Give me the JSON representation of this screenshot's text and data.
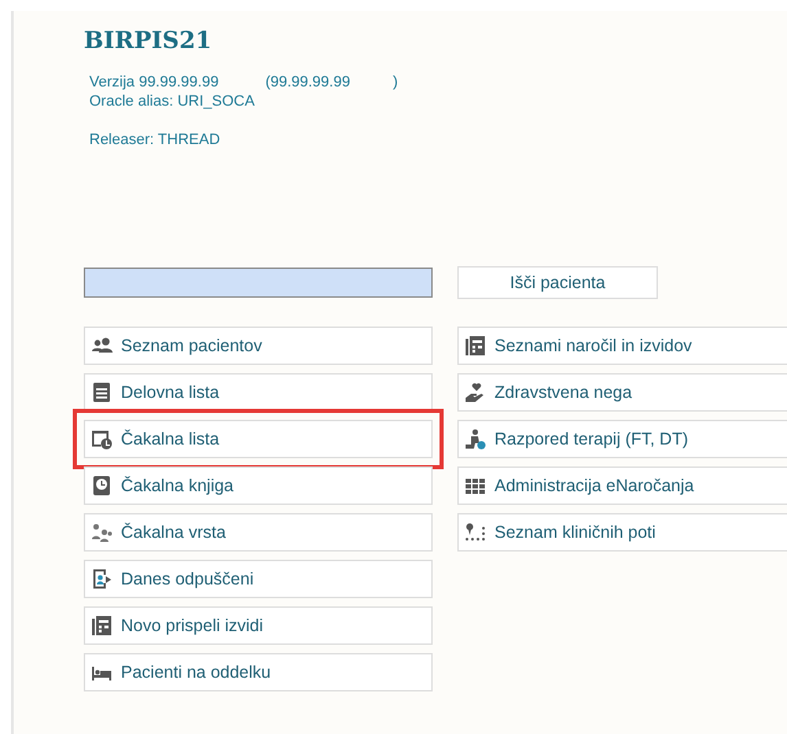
{
  "app": {
    "title": "BIRPIS21",
    "version_label": "Verzija 99.99.99.99",
    "version_build": "(99.99.99.99",
    "version_close": ")",
    "oracle_alias": "Oracle alias: URI_SOCA",
    "releaser": "Releaser: THREAD"
  },
  "search": {
    "button": "Išči pacienta"
  },
  "left_menu": [
    {
      "label": "Seznam pacientov",
      "highlighted": false
    },
    {
      "label": "Delovna lista",
      "highlighted": false
    },
    {
      "label": "Čakalna lista",
      "highlighted": true
    },
    {
      "label": "Čakalna knjiga",
      "highlighted": false
    },
    {
      "label": "Čakalna vrsta",
      "highlighted": false
    },
    {
      "label": "Danes odpuščeni",
      "highlighted": false
    },
    {
      "label": "Novo prispeli izvidi",
      "highlighted": false
    },
    {
      "label": "Pacienti na oddelku",
      "highlighted": false
    }
  ],
  "right_menu": [
    {
      "label": "Seznami naročil in izvidov",
      "highlighted": false
    },
    {
      "label": "Zdravstvena nega",
      "highlighted": false
    },
    {
      "label": "Razpored terapij (FT, DT)",
      "highlighted": false
    },
    {
      "label": "Administracija eNaročanja",
      "highlighted": false
    },
    {
      "label": "Seznam kliničnih poti",
      "highlighted": false
    }
  ]
}
